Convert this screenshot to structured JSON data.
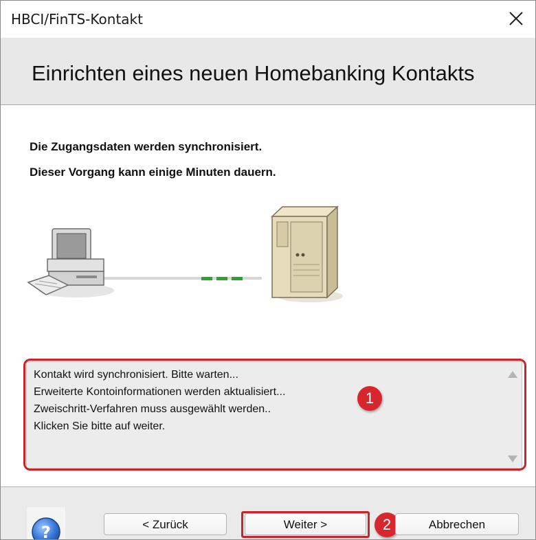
{
  "window": {
    "title": "HBCI/FinTS-Kontakt"
  },
  "header": {
    "heading": "Einrichten eines neuen Homebanking Kontakts"
  },
  "content": {
    "message_1": "Die Zugangsdaten werden synchronisiert.",
    "message_2": "Dieser Vorgang kann einige Minuten dauern.",
    "illustration": {
      "left": "computer-icon",
      "right": "server-icon",
      "progress_segments": 3
    },
    "log_lines": [
      "Kontakt wird synchronisiert. Bitte warten...",
      "Erweiterte Kontoinformationen werden aktualisiert...",
      "Zweischritt-Verfahren muss ausgewählt werden..",
      "Klicken Sie bitte auf weiter."
    ]
  },
  "footer": {
    "help_icon": "help-icon",
    "back_label": "< Zurück",
    "next_label": "Weiter >",
    "cancel_label": "Abbrechen"
  },
  "annotations": {
    "badge_1": "1",
    "badge_2": "2",
    "color": "#d8262e"
  }
}
